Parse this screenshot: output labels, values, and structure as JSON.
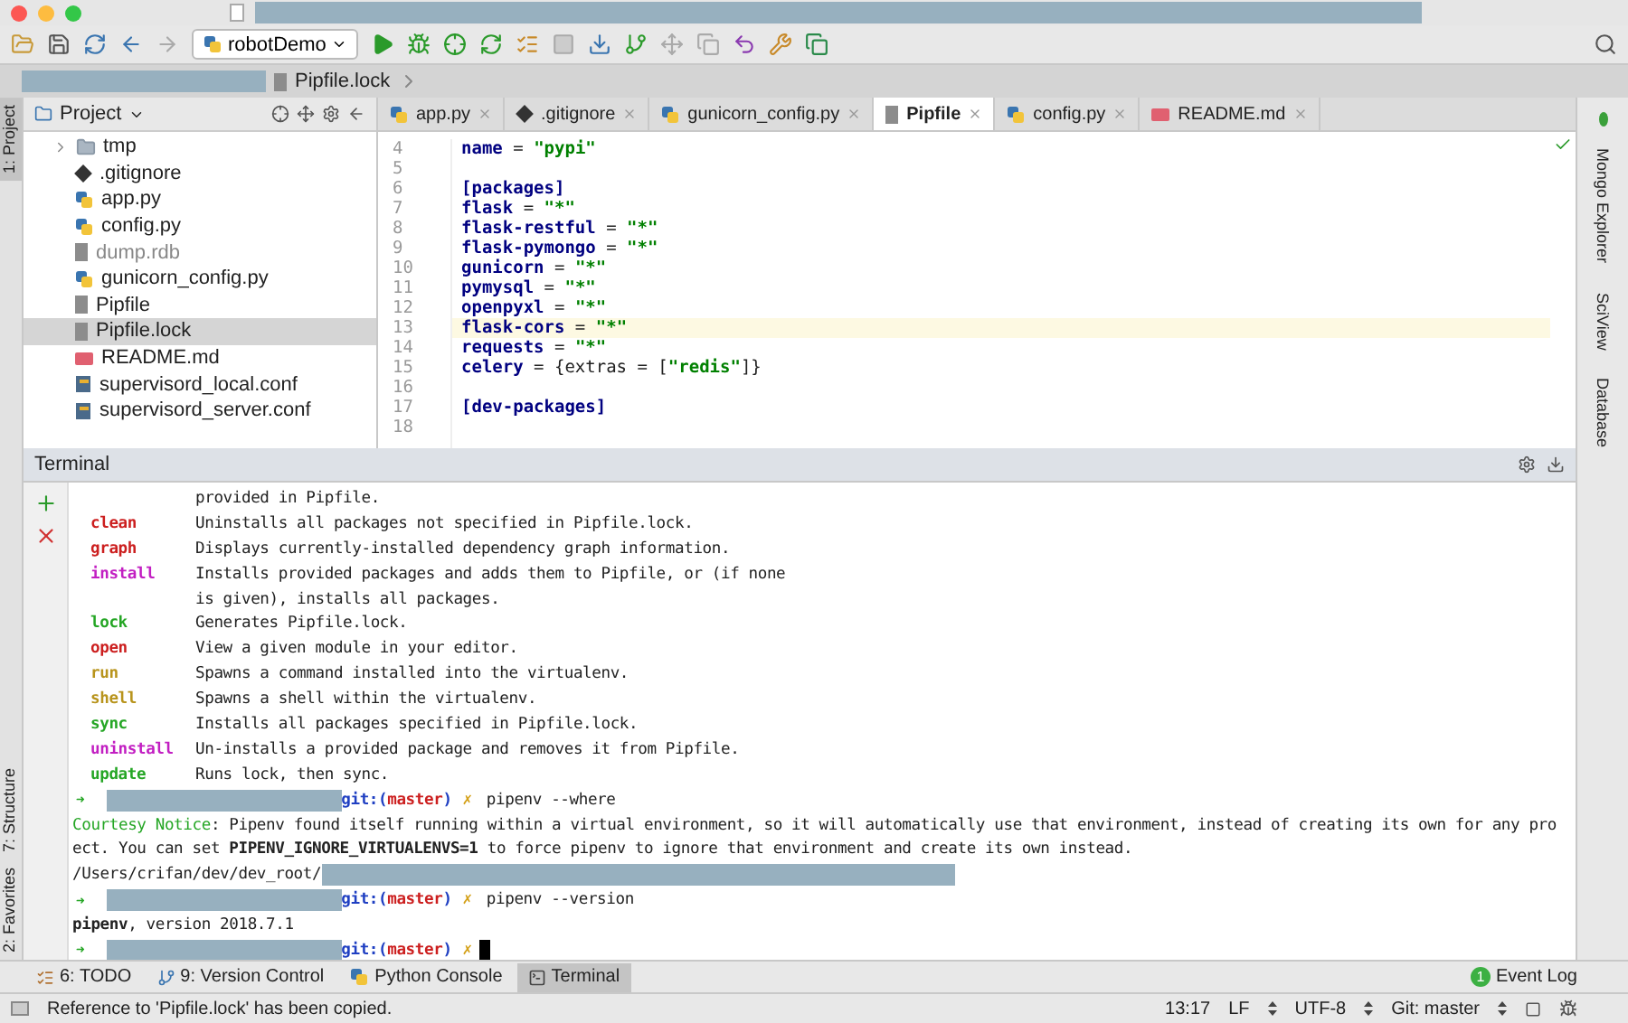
{
  "toolbar": {
    "run_config": "robotDemo"
  },
  "breadcrumb": {
    "file": "Pipfile.lock"
  },
  "left_strip": [
    {
      "label": "1: Project",
      "selected": true
    },
    {
      "label": "7: Structure",
      "selected": false
    },
    {
      "label": "2: Favorites",
      "selected": false
    }
  ],
  "right_strip": [
    {
      "label": "Mongo Explorer"
    },
    {
      "label": "SciView"
    },
    {
      "label": "Database"
    }
  ],
  "project": {
    "title": "Project",
    "items": [
      {
        "name": "tmp",
        "kind": "folder",
        "selected": false,
        "dim": false
      },
      {
        "name": ".gitignore",
        "kind": "git",
        "selected": false,
        "dim": false
      },
      {
        "name": "app.py",
        "kind": "python",
        "selected": false,
        "dim": false
      },
      {
        "name": "config.py",
        "kind": "python",
        "selected": false,
        "dim": false
      },
      {
        "name": "dump.rdb",
        "kind": "file",
        "selected": false,
        "dim": true
      },
      {
        "name": "gunicorn_config.py",
        "kind": "python",
        "selected": false,
        "dim": false
      },
      {
        "name": "Pipfile",
        "kind": "file",
        "selected": false,
        "dim": false
      },
      {
        "name": "Pipfile.lock",
        "kind": "file",
        "selected": true,
        "dim": false
      },
      {
        "name": "README.md",
        "kind": "markdown",
        "selected": false,
        "dim": false
      },
      {
        "name": "supervisord_local.conf",
        "kind": "conf",
        "selected": false,
        "dim": false
      },
      {
        "name": "supervisord_server.conf",
        "kind": "conf",
        "selected": false,
        "dim": false
      }
    ]
  },
  "tabs": [
    {
      "label": "app.py",
      "kind": "python",
      "selected": false
    },
    {
      "label": ".gitignore",
      "kind": "git",
      "selected": false
    },
    {
      "label": "gunicorn_config.py",
      "kind": "python",
      "selected": false
    },
    {
      "label": "Pipfile",
      "kind": "file",
      "selected": true
    },
    {
      "label": "config.py",
      "kind": "python",
      "selected": false
    },
    {
      "label": "README.md",
      "kind": "markdown",
      "selected": false
    }
  ],
  "editor": {
    "lines": [
      {
        "number": "4",
        "current": false,
        "parts": [
          {
            "kind": "key",
            "text": "name"
          },
          {
            "kind": "plain",
            "text": " = "
          },
          {
            "kind": "string",
            "text": "\"pypi\""
          }
        ]
      },
      {
        "number": "5",
        "current": false
      },
      {
        "number": "6",
        "current": false,
        "parts": [
          {
            "kind": "key",
            "text": "[packages]"
          }
        ]
      },
      {
        "number": "7",
        "current": false,
        "parts": [
          {
            "kind": "key",
            "text": "flask"
          },
          {
            "kind": "plain",
            "text": " = "
          },
          {
            "kind": "string",
            "text": "\"*\""
          }
        ]
      },
      {
        "number": "8",
        "current": false,
        "parts": [
          {
            "kind": "key",
            "text": "flask-restful"
          },
          {
            "kind": "plain",
            "text": " = "
          },
          {
            "kind": "string",
            "text": "\"*\""
          }
        ]
      },
      {
        "number": "9",
        "current": false,
        "parts": [
          {
            "kind": "key",
            "text": "flask-pymongo"
          },
          {
            "kind": "plain",
            "text": " = "
          },
          {
            "kind": "string",
            "text": "\"*\""
          }
        ]
      },
      {
        "number": "10",
        "current": false,
        "parts": [
          {
            "kind": "key",
            "text": "gunicorn"
          },
          {
            "kind": "plain",
            "text": " = "
          },
          {
            "kind": "string",
            "text": "\"*\""
          }
        ]
      },
      {
        "number": "11",
        "current": false,
        "parts": [
          {
            "kind": "key",
            "text": "pymysql"
          },
          {
            "kind": "plain",
            "text": " = "
          },
          {
            "kind": "string",
            "text": "\"*\""
          }
        ]
      },
      {
        "number": "12",
        "current": false,
        "parts": [
          {
            "kind": "key",
            "text": "openpyxl"
          },
          {
            "kind": "plain",
            "text": " = "
          },
          {
            "kind": "string",
            "text": "\"*\""
          }
        ]
      },
      {
        "number": "13",
        "current": true,
        "parts": [
          {
            "kind": "key",
            "text": "flask-cors"
          },
          {
            "kind": "plain",
            "text": " = "
          },
          {
            "kind": "string",
            "text": "\"*\""
          }
        ]
      },
      {
        "number": "14",
        "current": false,
        "parts": [
          {
            "kind": "key",
            "text": "requests"
          },
          {
            "kind": "plain",
            "text": " = "
          },
          {
            "kind": "string",
            "text": "\"*\""
          }
        ]
      },
      {
        "number": "15",
        "current": false,
        "parts": [
          {
            "kind": "key",
            "text": "celery"
          },
          {
            "kind": "plain",
            "text": " = {extras = ["
          },
          {
            "kind": "string",
            "text": "\"redis\""
          },
          {
            "kind": "plain",
            "text": "]}"
          }
        ]
      },
      {
        "number": "16",
        "current": false
      },
      {
        "number": "17",
        "current": false,
        "parts": [
          {
            "kind": "key",
            "text": "[dev-packages]"
          }
        ]
      },
      {
        "number": "18",
        "current": false
      }
    ]
  },
  "terminal": {
    "title": "Terminal",
    "lines": [
      {
        "kind": "cont",
        "text": "provided in Pipfile."
      },
      {
        "kind": "cmd",
        "name": "clean",
        "color": "#cc1f1f",
        "text": "Uninstalls all packages not specified in Pipfile.lock."
      },
      {
        "kind": "cmd",
        "name": "graph",
        "color": "#cc1f1f",
        "text": "Displays currently-installed dependency graph information."
      },
      {
        "kind": "cmd",
        "name": "install",
        "color": "#c21fc2",
        "text": "Installs provided packages and adds them to Pipfile, or (if none"
      },
      {
        "kind": "cont",
        "text": "is given), installs all packages."
      },
      {
        "kind": "cmd",
        "name": "lock",
        "color": "#25a625",
        "text": "Generates Pipfile.lock."
      },
      {
        "kind": "cmd",
        "name": "open",
        "color": "#cc1f1f",
        "text": "View a given module in your editor."
      },
      {
        "kind": "cmd",
        "name": "run",
        "color": "#b8941c",
        "text": "Spawns a command installed into the virtualenv."
      },
      {
        "kind": "cmd",
        "name": "shell",
        "color": "#b8941c",
        "text": "Spawns a shell within the virtualenv."
      },
      {
        "kind": "cmd",
        "name": "sync",
        "color": "#25a625",
        "text": "Installs all packages specified in Pipfile.lock."
      },
      {
        "kind": "cmd",
        "name": "uninstall",
        "color": "#c21fc2",
        "text": "Un-installs a provided package and removes it from Pipfile."
      },
      {
        "kind": "cmd",
        "name": "update",
        "color": "#25a625",
        "text": "Runs lock, then sync."
      },
      {
        "kind": "prompt",
        "arrow": "➜",
        "vcs": "git:(",
        "branch": "master",
        "close": ")",
        "dirty": "✗",
        "command": "pipenv --where"
      },
      {
        "kind": "notice",
        "label": "Courtesy Notice",
        "text": ": Pipenv found itself running within a virtual environment, so it will automatically use that environment, instead of creating its own for any pro"
      },
      {
        "kind": "text",
        "text": "ect. You can set **PIPENV_IGNORE_VIRTUALENVS=1** to force pipenv to ignore that environment and create its own instead."
      },
      {
        "kind": "path",
        "text": "/Users/crifan/dev/dev_root/"
      },
      {
        "kind": "prompt",
        "arrow": "➜",
        "vcs": "git:(",
        "branch": "master",
        "close": ")",
        "dirty": "✗",
        "command": "pipenv --version"
      },
      {
        "kind": "text",
        "text": "**pipenv**, version 2018.7.1"
      },
      {
        "kind": "prompt",
        "arrow": "➜",
        "vcs": "git:(",
        "branch": "master",
        "close": ")",
        "dirty": "✗",
        "cursor": true
      }
    ]
  },
  "tool_windows": [
    {
      "label": "6: TODO",
      "kind": "todo",
      "selected": false
    },
    {
      "label": "9: Version Control",
      "kind": "vcs",
      "selected": false
    },
    {
      "label": "Python Console",
      "kind": "python",
      "selected": false
    },
    {
      "label": "Terminal",
      "kind": "terminal",
      "selected": true
    }
  ],
  "event_log": {
    "badge": "1",
    "label": "Event Log"
  },
  "status_bar": {
    "message": "Reference to 'Pipfile.lock' has been copied.",
    "position": "13:17",
    "line_sep": "LF",
    "encoding": "UTF-8",
    "branch": "Git: master"
  }
}
